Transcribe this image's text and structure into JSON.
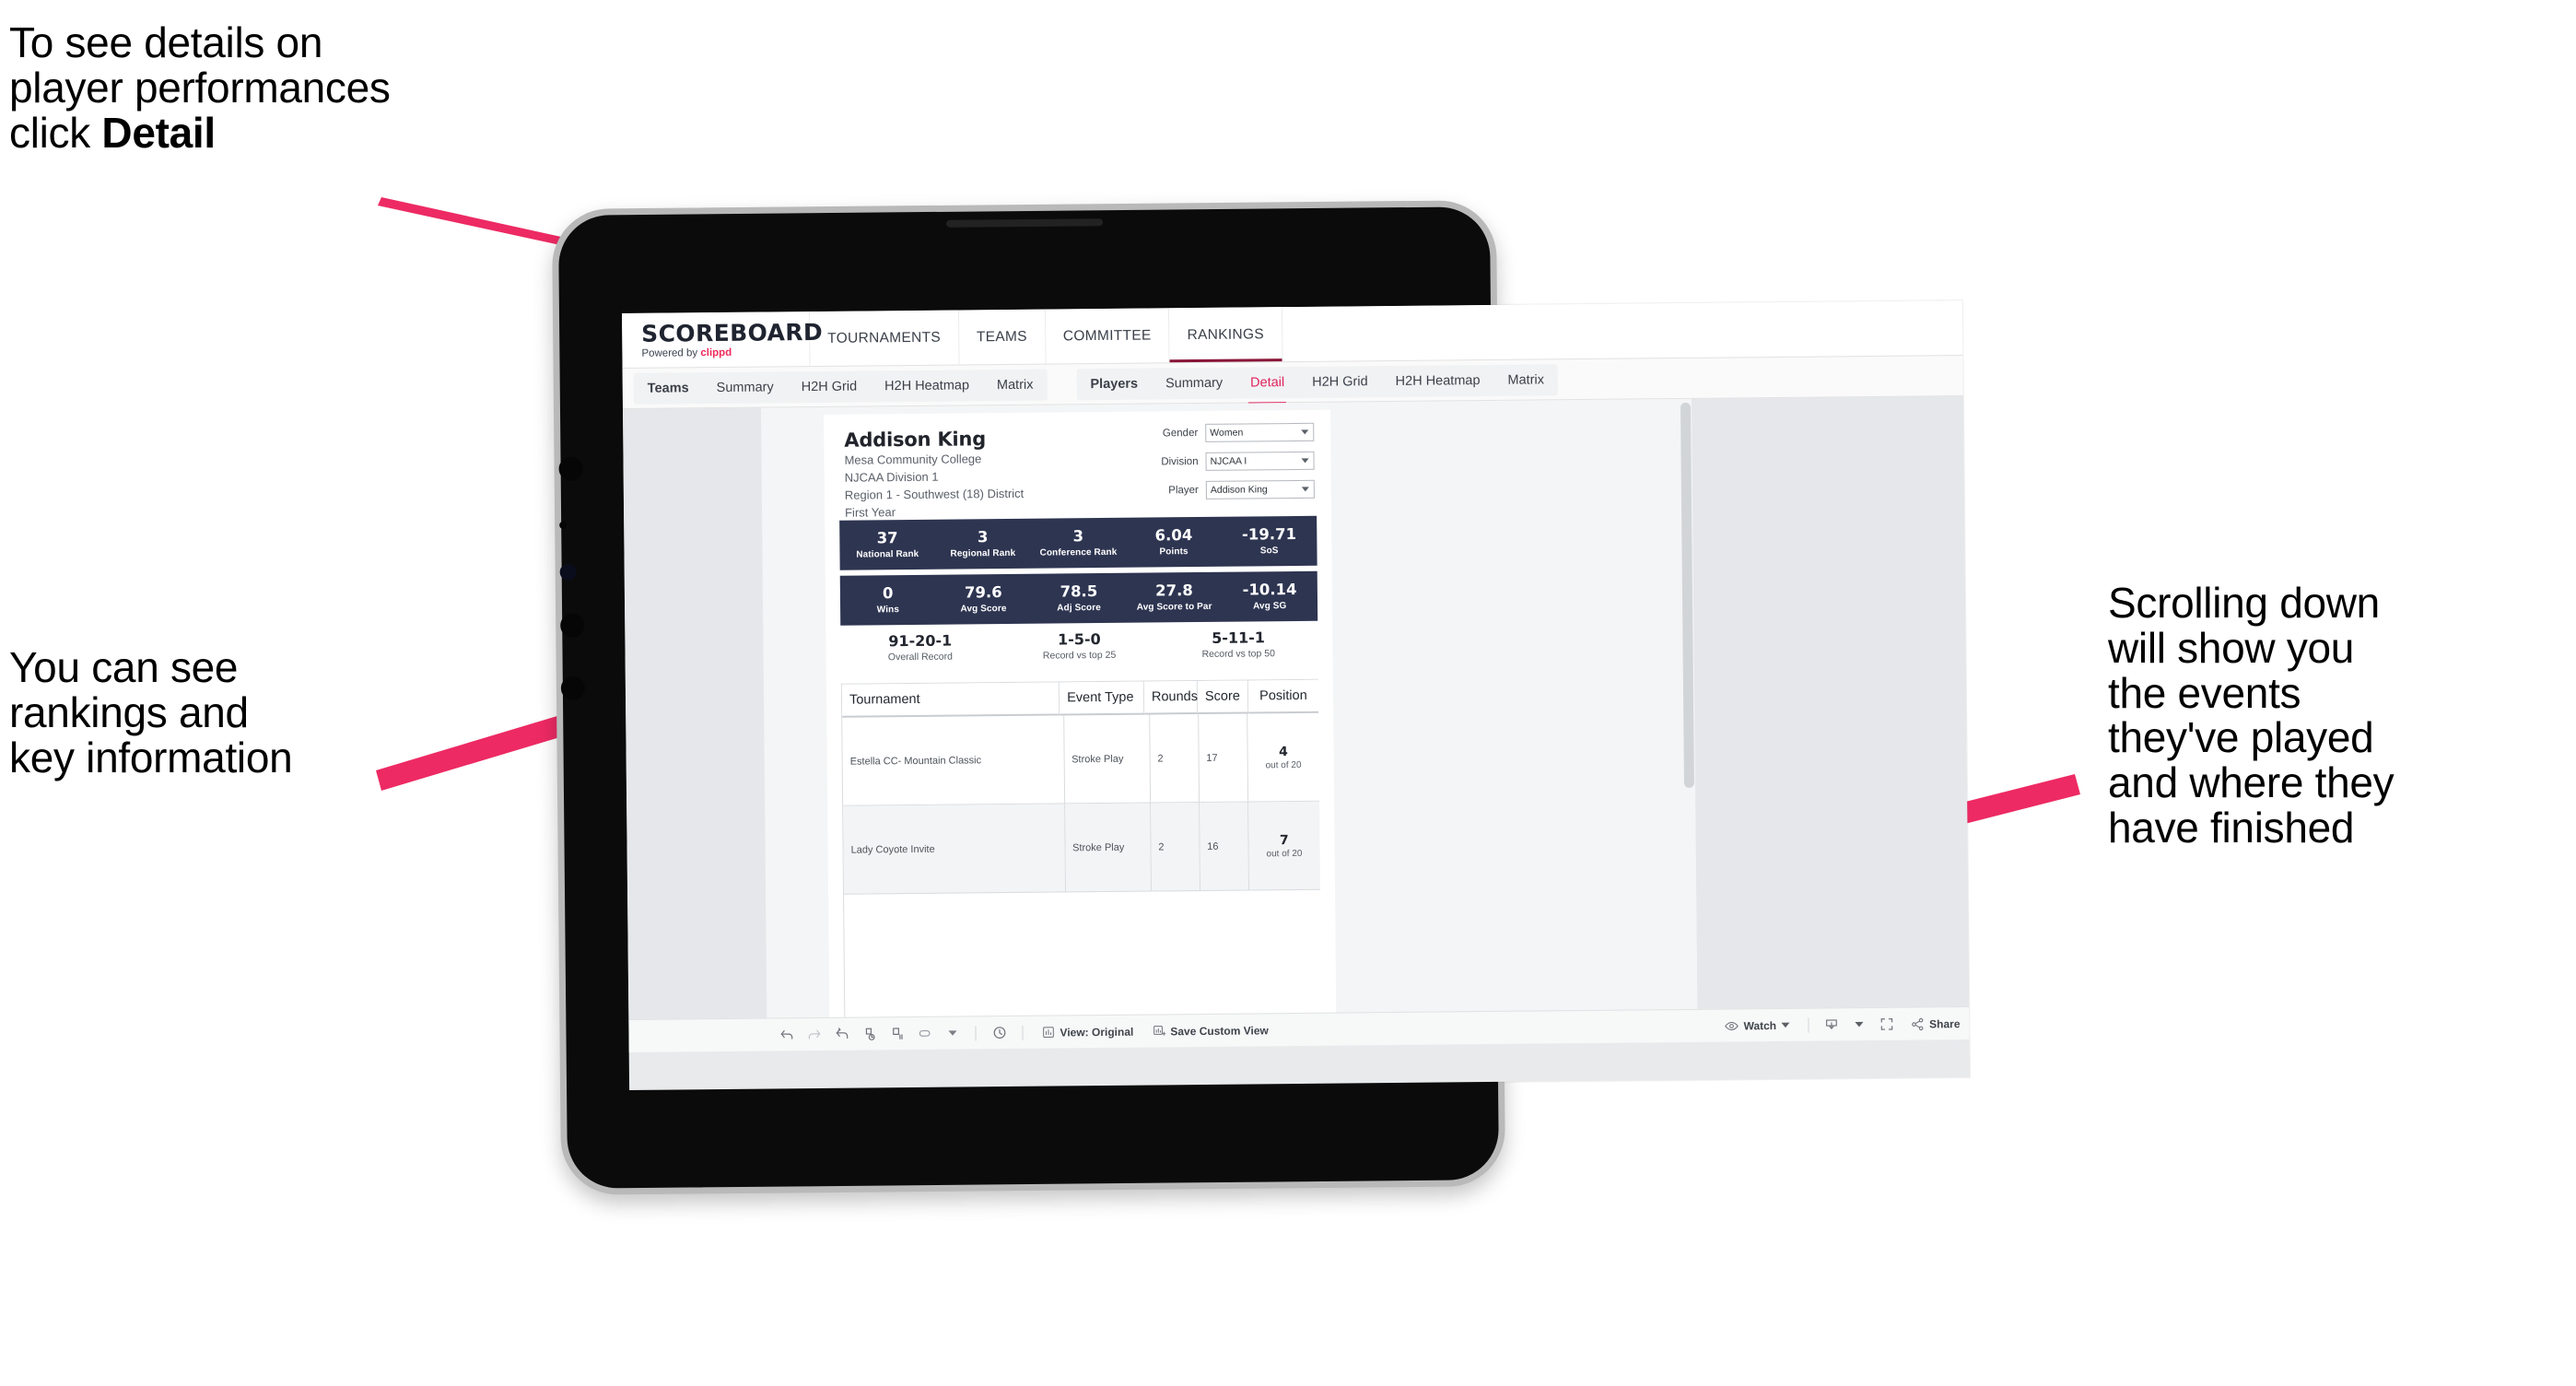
{
  "annotations": {
    "detail": "To see details on\nplayer performances\nclick ",
    "detail_bold": "Detail",
    "rankings": "You can see\nrankings and\nkey information",
    "scrolling": "Scrolling down\nwill show you\nthe events\nthey've played\nand where they\nhave finished"
  },
  "app": {
    "brand": {
      "title": "SCOREBOARD",
      "powered_prefix": "Powered by ",
      "powered_name": "clippd"
    },
    "top_nav": [
      {
        "label": "TOURNAMENTS",
        "active": false
      },
      {
        "label": "TEAMS",
        "active": false
      },
      {
        "label": "COMMITTEE",
        "active": false
      },
      {
        "label": "RANKINGS",
        "active": true
      }
    ],
    "tab_groups": [
      {
        "head": "Teams",
        "tabs": [
          "Summary",
          "H2H Grid",
          "H2H Heatmap",
          "Matrix"
        ],
        "selected": null
      },
      {
        "head": "Players",
        "tabs": [
          "Summary",
          "Detail",
          "H2H Grid",
          "H2H Heatmap",
          "Matrix"
        ],
        "selected": "Detail"
      }
    ]
  },
  "player": {
    "name": "Addison King",
    "school": "Mesa Community College",
    "division": "NJCAA Division 1",
    "region": "Region 1 - Southwest (18) District",
    "year": "First Year"
  },
  "filters": [
    {
      "label": "Gender",
      "value": "Women"
    },
    {
      "label": "Division",
      "value": "NJCAA I"
    },
    {
      "label": "Player",
      "value": "Addison King"
    }
  ],
  "stats_row1": [
    {
      "value": "37",
      "label": "National Rank"
    },
    {
      "value": "3",
      "label": "Regional Rank"
    },
    {
      "value": "3",
      "label": "Conference Rank"
    },
    {
      "value": "6.04",
      "label": "Points"
    },
    {
      "value": "-19.71",
      "label": "SoS"
    }
  ],
  "stats_row2": [
    {
      "value": "0",
      "label": "Wins"
    },
    {
      "value": "79.6",
      "label": "Avg Score"
    },
    {
      "value": "78.5",
      "label": "Adj Score"
    },
    {
      "value": "27.8",
      "label": "Avg Score to Par"
    },
    {
      "value": "-10.14",
      "label": "Avg SG"
    }
  ],
  "records": [
    {
      "value": "91-20-1",
      "label": "Overall Record"
    },
    {
      "value": "1-5-0",
      "label": "Record vs top 25"
    },
    {
      "value": "5-11-1",
      "label": "Record vs top 50"
    }
  ],
  "table": {
    "columns": [
      "Tournament",
      "Event Type",
      "Rounds",
      "Score",
      "Position"
    ],
    "rows": [
      {
        "tournament": "Estella CC- Mountain Classic",
        "event_type": "Stroke Play",
        "rounds": "2",
        "score": "17",
        "position": "4",
        "position_out_of": "out of 20"
      },
      {
        "tournament": "Lady Coyote Invite",
        "event_type": "Stroke Play",
        "rounds": "2",
        "score": "16",
        "position": "7",
        "position_out_of": "out of 20"
      }
    ]
  },
  "bottom_toolbar": {
    "view_label": "View: Original",
    "save_label": "Save Custom View",
    "watch_label": "Watch",
    "share_label": "Share"
  },
  "colors": {
    "accent_pink": "#e0245e",
    "arrow_pink": "#ed2a63",
    "navy": "#2e3551",
    "maroon": "#8a1538"
  }
}
